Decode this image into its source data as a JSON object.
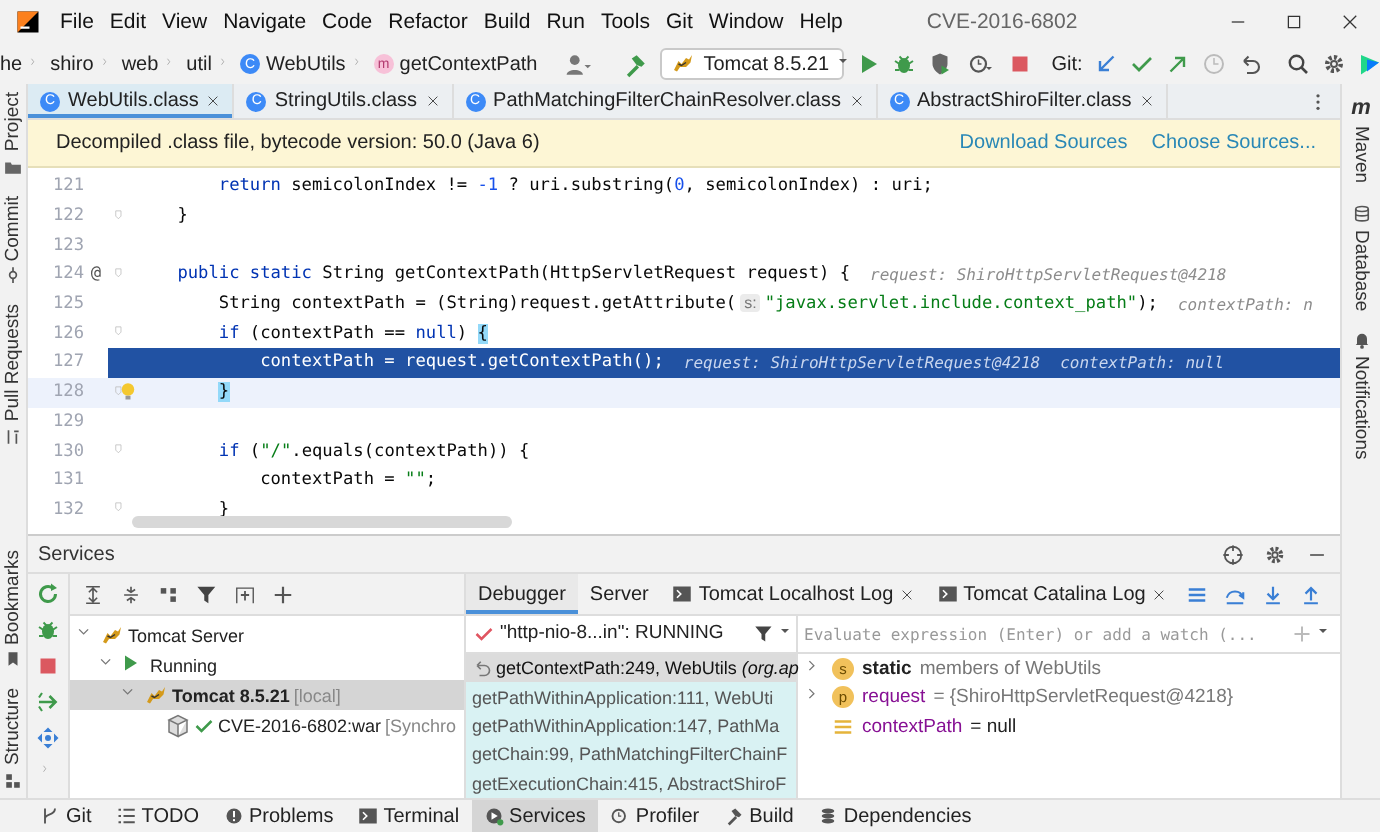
{
  "menu_bar": {
    "items": [
      "File",
      "Edit",
      "View",
      "Navigate",
      "Code",
      "Refactor",
      "Build",
      "Run",
      "Tools",
      "Git",
      "Window",
      "Help"
    ],
    "title": "CVE-2016-6802"
  },
  "navigation": {
    "breadcrumbs": [
      {
        "label": "he",
        "kind": "folder"
      },
      {
        "label": "shiro",
        "kind": "folder"
      },
      {
        "label": "web",
        "kind": "folder"
      },
      {
        "label": "util",
        "kind": "folder"
      },
      {
        "label": "WebUtils",
        "kind": "class",
        "badge": "C"
      },
      {
        "label": "getContextPath",
        "kind": "method",
        "badge": "m"
      }
    ],
    "run_config": "Tomcat 8.5.21",
    "git_label": "Git:"
  },
  "left_tools_top": [
    {
      "label": "Project",
      "kind": "project"
    },
    {
      "label": "Commit",
      "kind": "commit"
    },
    {
      "label": "Pull Requests",
      "kind": "pull"
    }
  ],
  "left_tools_bottom": [
    {
      "label": "Bookmarks",
      "kind": "bookmark"
    },
    {
      "label": "Structure",
      "kind": "structure"
    }
  ],
  "right_tools": [
    {
      "label": "Maven",
      "kind": "maven",
      "badge": "m"
    },
    {
      "label": "Database",
      "kind": "database"
    },
    {
      "label": "Notifications",
      "kind": "bell"
    }
  ],
  "editor_tabs": [
    {
      "label": "WebUtils.class",
      "badge": "C",
      "selected": true
    },
    {
      "label": "StringUtils.class",
      "badge": "C",
      "selected": false
    },
    {
      "label": "PathMatchingFilterChainResolver.class",
      "badge": "C",
      "selected": false
    },
    {
      "label": "AbstractShiroFilter.class",
      "badge": "C",
      "selected": false
    }
  ],
  "banner": {
    "text": "Decompiled .class file, bytecode version: 50.0 (Java 6)",
    "links": [
      "Download Sources",
      "Choose Sources..."
    ]
  },
  "code_lines": [
    {
      "number": "121",
      "tokens": [
        {
          "kind": "keyword",
          "text": "        return"
        },
        {
          "kind": "plain",
          "text": " semicolonIndex != "
        },
        {
          "kind": "number",
          "text": "-1"
        },
        {
          "kind": "plain",
          "text": " ? uri.substring("
        },
        {
          "kind": "number",
          "text": "0"
        },
        {
          "kind": "plain",
          "text": ", semicolonIndex) : uri;"
        }
      ],
      "fold": false,
      "selected": false,
      "caret": false,
      "intention": false
    },
    {
      "number": "122",
      "tokens": [
        {
          "kind": "plain",
          "text": "    }"
        }
      ],
      "fold": true,
      "selected": false,
      "caret": false,
      "intention": false
    },
    {
      "number": "123",
      "fold": false,
      "selected": false,
      "caret": false,
      "intention": false
    },
    {
      "number": "124",
      "gutter_mark": "@",
      "tokens": [
        {
          "kind": "keyword",
          "text": "    public static"
        },
        {
          "kind": "plain",
          "text": " String getContextPath(HttpServletRequest request) {"
        }
      ],
      "hints": [
        "request: ShiroHttpServletRequest@4218"
      ],
      "fold": true,
      "selected": false,
      "caret": false,
      "intention": false
    },
    {
      "number": "125",
      "tokens": [
        {
          "kind": "plain",
          "text": "        String contextPath = (String)request.getAttribute("
        },
        {
          "kind": "param_hint",
          "text": "s:"
        },
        {
          "kind": "string",
          "text": "\"javax.servlet.include.context_path\""
        },
        {
          "kind": "plain",
          "text": ");"
        }
      ],
      "hints": [
        "contextPath: n"
      ],
      "fold": false,
      "selected": false,
      "caret": false,
      "intention": false
    },
    {
      "number": "126",
      "tokens": [
        {
          "kind": "keyword",
          "text": "        if"
        },
        {
          "kind": "plain",
          "text": " (contextPath == "
        },
        {
          "kind": "keyword",
          "text": "null"
        },
        {
          "kind": "plain",
          "text": ") "
        },
        {
          "kind": "brace",
          "text": "{"
        }
      ],
      "fold": true,
      "selected": false,
      "caret": false,
      "intention": false
    },
    {
      "number": "127",
      "tokens": [
        {
          "kind": "plain",
          "text": "            contextPath = request.getContextPath();"
        }
      ],
      "hints": [
        "request: ShiroHttpServletRequest@4218",
        "contextPath: null"
      ],
      "fold": false,
      "selected": true,
      "caret": false,
      "intention": false
    },
    {
      "number": "128",
      "tokens": [
        {
          "kind": "brace",
          "text": "        }"
        }
      ],
      "fold": true,
      "selected": false,
      "caret": true,
      "intention": true
    },
    {
      "number": "129",
      "fold": false,
      "selected": false,
      "caret": false,
      "intention": false
    },
    {
      "number": "130",
      "tokens": [
        {
          "kind": "keyword",
          "text": "        if"
        },
        {
          "kind": "plain",
          "text": " ("
        },
        {
          "kind": "string",
          "text": "\"/\""
        },
        {
          "kind": "plain",
          "text": ".equals(contextPath)) {"
        }
      ],
      "fold": true,
      "selected": false,
      "caret": false,
      "intention": false
    },
    {
      "number": "131",
      "tokens": [
        {
          "kind": "plain",
          "text": "            contextPath = "
        },
        {
          "kind": "string",
          "text": "\"\""
        },
        {
          "kind": "plain",
          "text": ";"
        }
      ],
      "fold": false,
      "selected": false,
      "caret": false,
      "intention": false
    },
    {
      "number": "132",
      "tokens": [
        {
          "kind": "plain",
          "text": "        }"
        }
      ],
      "fold": true,
      "selected": false,
      "caret": false,
      "intention": false
    }
  ],
  "services": {
    "title": "Services",
    "tree": [
      {
        "label": "Tomcat Server",
        "kind": "server",
        "expanded": true,
        "selected": false,
        "children": [
          {
            "label": "Running",
            "kind": "running",
            "expanded": true,
            "selected": false,
            "children": [
              {
                "label": "Tomcat 8.5.21",
                "note": "[local]",
                "kind": "instance",
                "expanded": true,
                "selected": true,
                "children": [
                  {
                    "label": "CVE-2016-6802:war",
                    "note": "[Synchro",
                    "kind": "artifact",
                    "selected": false
                  }
                ]
              }
            ]
          }
        ]
      }
    ],
    "tabs": [
      {
        "label": "Debugger",
        "kind": "plain",
        "selected": true
      },
      {
        "label": "Server",
        "kind": "plain",
        "selected": false
      },
      {
        "label": "Tomcat Localhost Log",
        "kind": "log",
        "selected": false
      },
      {
        "label": "Tomcat Catalina Log",
        "kind": "log",
        "selected": false
      }
    ],
    "thread": "\"http-nio-8...in\": RUNNING",
    "frames": [
      {
        "label": "getContextPath:249, WebUtils *(org.ap*",
        "kind": "project",
        "selected": true
      },
      {
        "label": "getPathWithinApplication:111, WebUti",
        "kind": "library",
        "selected": false
      },
      {
        "label": "getPathWithinApplication:147, PathMa",
        "kind": "library",
        "selected": false
      },
      {
        "label": "getChain:99, PathMatchingFilterChainF",
        "kind": "library",
        "selected": false
      },
      {
        "label": "getExecutionChain:415, AbstractShiroF",
        "kind": "library",
        "selected": false
      }
    ],
    "evaluate_placeholder": "Evaluate expression (Enter) or add a watch (...",
    "variables": [
      {
        "kind": "static",
        "badge": "s",
        "name": "static",
        "value": "members of WebUtils",
        "expandable": true
      },
      {
        "kind": "param",
        "badge": "p",
        "name": "request",
        "value": "= {ShiroHttpServletRequest@4218}",
        "expandable": true
      },
      {
        "kind": "field",
        "name": "contextPath",
        "value": "= null",
        "expandable": false
      }
    ]
  },
  "bottom_tools": [
    {
      "label": "Git",
      "kind": "git",
      "selected": false
    },
    {
      "label": "TODO",
      "kind": "todo",
      "selected": false
    },
    {
      "label": "Problems",
      "kind": "problems",
      "selected": false
    },
    {
      "label": "Terminal",
      "kind": "terminal",
      "selected": false
    },
    {
      "label": "Services",
      "kind": "services",
      "selected": true
    },
    {
      "label": "Profiler",
      "kind": "profiler",
      "selected": false
    },
    {
      "label": "Build",
      "kind": "build",
      "selected": false
    },
    {
      "label": "Dependencies",
      "kind": "dependencies",
      "selected": false
    }
  ]
}
